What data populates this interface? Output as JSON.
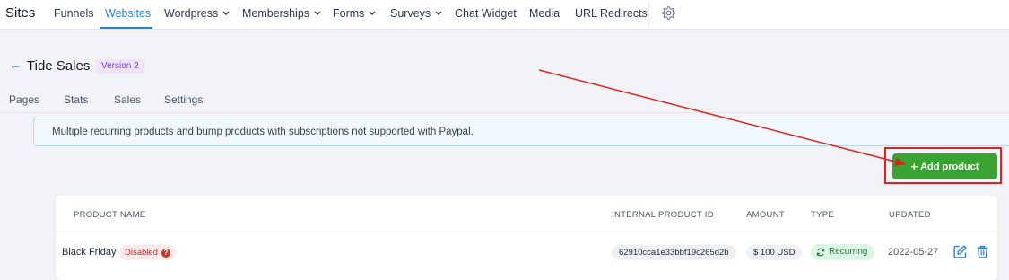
{
  "topnav": {
    "brand": "Sites",
    "items": [
      {
        "label": "Funnels"
      },
      {
        "label": "Websites"
      },
      {
        "label": "Wordpress"
      },
      {
        "label": "Memberships"
      },
      {
        "label": "Forms"
      },
      {
        "label": "Surveys"
      },
      {
        "label": "Chat Widget"
      },
      {
        "label": "Media"
      },
      {
        "label": "URL Redirects"
      }
    ],
    "active": "Websites",
    "settings_icon": "gear-icon"
  },
  "header": {
    "back_icon": "arrow-left-icon",
    "title": "Tide Sales",
    "version": "Version 2"
  },
  "subtabs": [
    {
      "label": "Pages"
    },
    {
      "label": "Stats"
    },
    {
      "label": "Sales"
    },
    {
      "label": "Settings"
    }
  ],
  "alert": {
    "text": "Multiple recurring products and bump products with subscriptions not supported with Paypal."
  },
  "toolbar": {
    "add_product_label": "Add product",
    "add_icon": "plus-icon"
  },
  "table": {
    "columns": [
      "PRODUCT NAME",
      "INTERNAL PRODUCT ID",
      "AMOUNT",
      "TYPE",
      "UPDATED"
    ],
    "rows": [
      {
        "name": "Black Friday",
        "status": "Disabled",
        "internal_id": "62910cca1e33bbf19c265d2b",
        "amount": "$ 100 USD",
        "type": "Recurring",
        "updated": "2022-05-27"
      }
    ]
  },
  "colors": {
    "accent": "#2b7fd4",
    "primary_button": "#38a32f",
    "annotation": "#e0211d",
    "disabled_badge": "#fde8e8",
    "recurring_badge": "#ddf5e6",
    "version_badge": "#efe4fb"
  }
}
